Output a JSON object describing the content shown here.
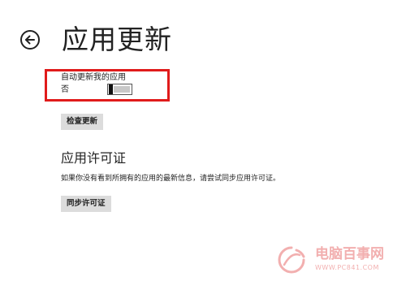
{
  "header": {
    "title": "应用更新",
    "back_icon": "back-arrow-icon"
  },
  "auto_update": {
    "label": "自动更新我的应用",
    "state_label": "否",
    "enabled": false
  },
  "actions": {
    "check_updates_label": "检查更新"
  },
  "license_section": {
    "title": "应用许可证",
    "description": "如果你没有看到所拥有的应用的最新信息，请尝试同步应用许可证。",
    "sync_label": "同步许可证"
  },
  "watermark": {
    "name": "电脑百事网",
    "url": "WWW.PC841.COM"
  },
  "colors": {
    "highlight": "#e01b1b",
    "button_bg": "#dcdcdc",
    "watermark": "#e86f6f"
  }
}
